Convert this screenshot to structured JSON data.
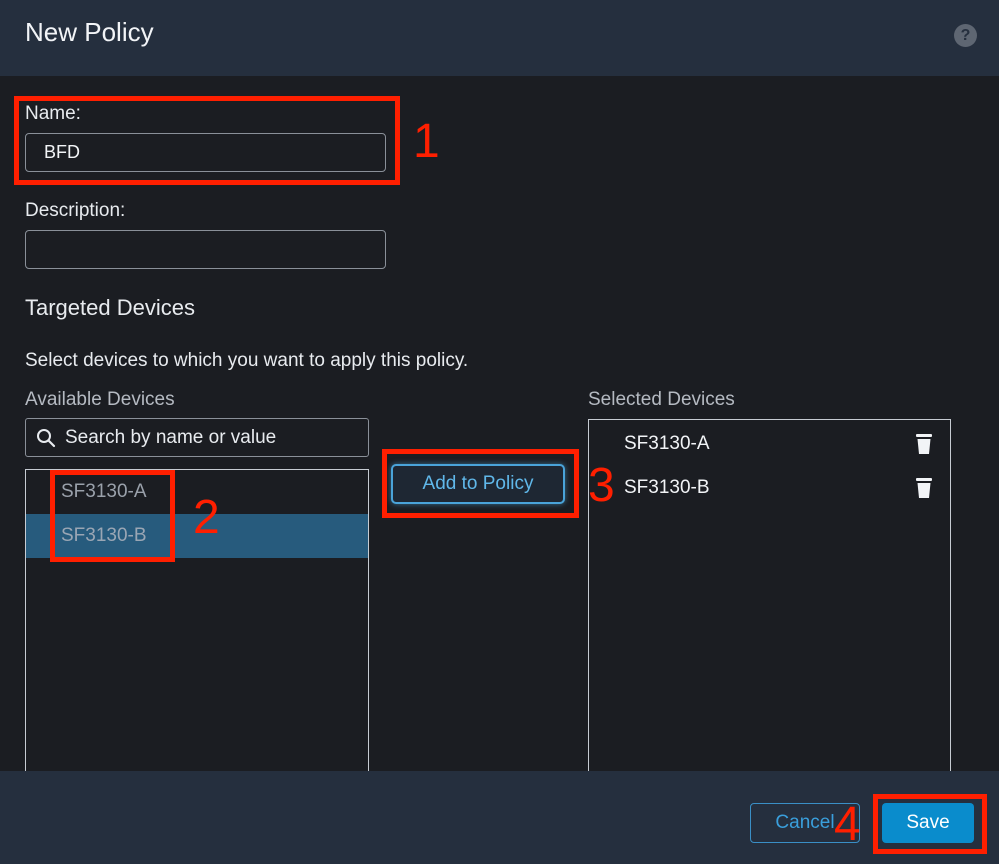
{
  "dialog": {
    "title": "New Policy",
    "help_glyph": "?"
  },
  "form": {
    "name_label": "Name:",
    "name_value": "BFD",
    "description_label": "Description:",
    "description_value": ""
  },
  "targeted": {
    "heading": "Targeted Devices",
    "instruction": "Select devices to which you want to apply this policy.",
    "available_label": "Available Devices",
    "selected_label": "Selected Devices",
    "search_placeholder": "Search by name or value",
    "available_devices": [
      {
        "name": "SF3130-A",
        "selected": false
      },
      {
        "name": "SF3130-B",
        "selected": true
      }
    ],
    "add_button": "Add to Policy",
    "selected_devices": [
      {
        "name": "SF3130-A"
      },
      {
        "name": "SF3130-B"
      }
    ]
  },
  "footer": {
    "cancel_label": "Cancel",
    "save_label": "Save"
  },
  "annotations": {
    "step1": "1",
    "step2": "2",
    "step3": "3",
    "step4": "4",
    "color": "#ff1f00"
  },
  "colors": {
    "header_bg": "#252f3e",
    "body_bg": "#1b1d22",
    "accent": "#0a8ccc",
    "selection": "#275b7d"
  },
  "icons": {
    "help": "help-icon",
    "search": "search-icon",
    "trash": "trash-icon"
  }
}
